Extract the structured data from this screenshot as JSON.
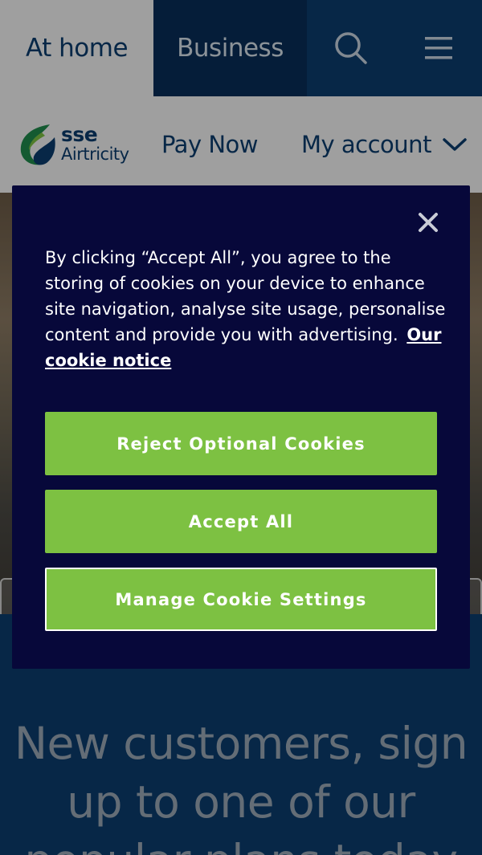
{
  "topbar": {
    "home_label": "At home",
    "business_label": "Business",
    "search_icon": "search-icon",
    "menu_icon": "hamburger-menu-icon"
  },
  "nav": {
    "logo_line1": "sse",
    "logo_line2": "Airtricity",
    "pay_now": "Pay Now",
    "my_account": "My account"
  },
  "hero": {
    "headline": "New customers, sign up to one of our popular plans today"
  },
  "cookie_modal": {
    "message": "By clicking “Accept All”, you agree to the storing of cookies on your device to enhance site navigation, analyse site usage, personalise content and provide you with advertising.",
    "link": "Our cookie notice",
    "reject": "Reject Optional Cookies",
    "accept": "Accept All",
    "manage": "Manage Cookie Settings"
  },
  "colors": {
    "navy": "#0b3d6e",
    "modal_bg": "#07083a",
    "accent_green": "#7dc142"
  }
}
